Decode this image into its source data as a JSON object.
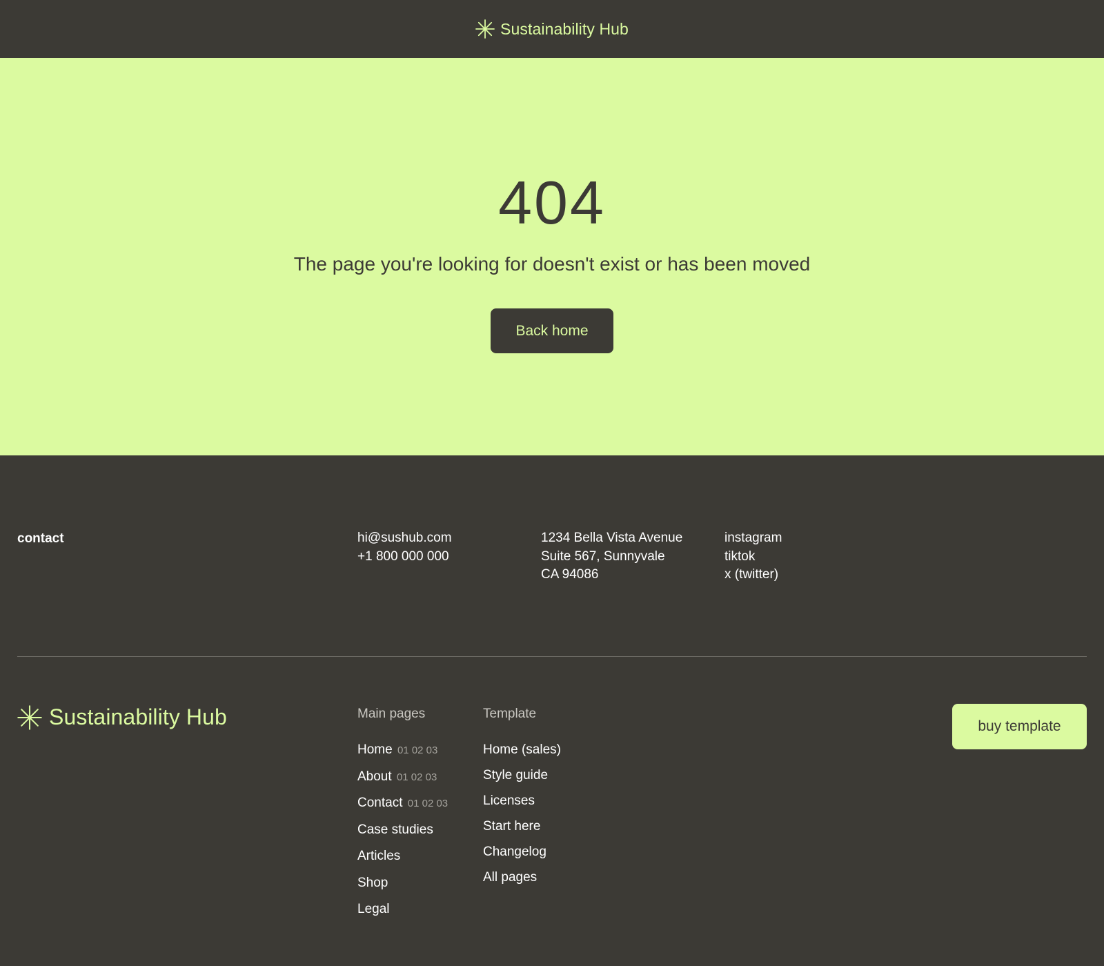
{
  "header": {
    "brand_name": "Sustainability Hub",
    "brand_icon": "asterisk-star-icon"
  },
  "hero": {
    "error_code": "404",
    "message": "The page you're looking for doesn't exist or has been moved",
    "button_label": "Back home"
  },
  "footer": {
    "contact_heading": "contact",
    "email": "hi@sushub.com",
    "phone": "+1 800 000 000",
    "address": [
      "1234 Bella Vista Avenue",
      "Suite 567, Sunnyvale",
      "CA 94086"
    ],
    "social": [
      "instagram",
      "tiktok",
      "x (twitter)"
    ],
    "brand_name": "Sustainability Hub",
    "main_pages": {
      "heading": "Main pages",
      "links": [
        {
          "label": "Home",
          "nums": "01 02 03"
        },
        {
          "label": "About",
          "nums": "01 02 03"
        },
        {
          "label": "Contact",
          "nums": "01 02 03"
        },
        {
          "label": "Case studies",
          "nums": ""
        },
        {
          "label": "Articles",
          "nums": ""
        },
        {
          "label": "Shop",
          "nums": ""
        },
        {
          "label": "Legal",
          "nums": ""
        }
      ]
    },
    "template": {
      "heading": "Template",
      "links": [
        "Home (sales)",
        "Style guide",
        "Licenses",
        "Start here",
        "Changelog",
        "All pages"
      ]
    },
    "buy_label": "buy template"
  },
  "colors": {
    "dark": "#3c3a35",
    "accent": "#dbfaa0",
    "divider": "#6c6a64",
    "muted": "#a5a39d"
  }
}
